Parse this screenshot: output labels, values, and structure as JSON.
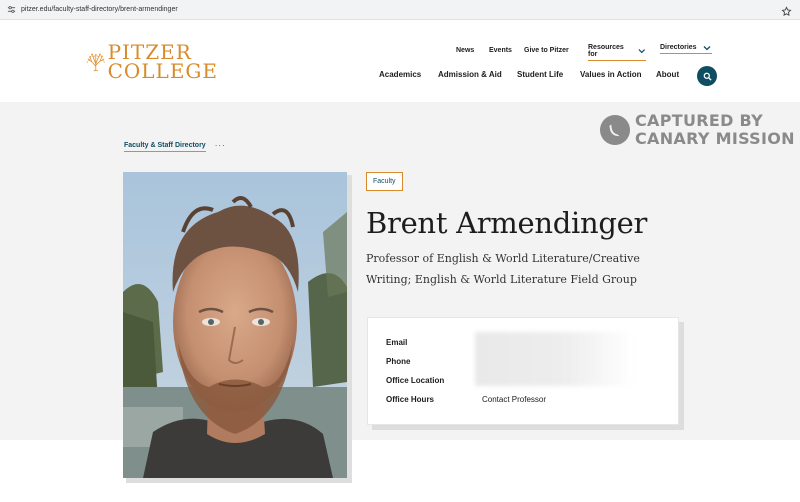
{
  "browser": {
    "url": "pitzer.edu/faculty-staff-directory/brent-armendinger"
  },
  "logo": {
    "line1": "PITZER",
    "line2": "COLLEGE",
    "brand_color": "#d98b2b"
  },
  "utility_nav": {
    "news": "News",
    "events": "Events",
    "give": "Give to Pitzer",
    "resources": "Resources for",
    "directories": "Directories"
  },
  "main_nav": {
    "academics": "Academics",
    "admission": "Admission & Aid",
    "student_life": "Student Life",
    "values": "Values in Action",
    "about": "About"
  },
  "watermark": {
    "line1": "CAPTURED BY",
    "line2": "CANARY MISSION"
  },
  "breadcrumb": {
    "label": "Faculty & Staff Directory",
    "more": "···"
  },
  "profile": {
    "badge": "Faculty",
    "name": "Brent Armendinger",
    "title": "Professor of English & World Literature/Creative Writing; English & World Literature Field Group"
  },
  "contact": {
    "email_label": "Email",
    "phone_label": "Phone",
    "office_location_label": "Office Location",
    "office_hours_label": "Office Hours",
    "office_hours_value": "Contact Professor"
  },
  "colors": {
    "accent_teal": "#0f4d63",
    "band_gray": "#f3f3f3"
  }
}
